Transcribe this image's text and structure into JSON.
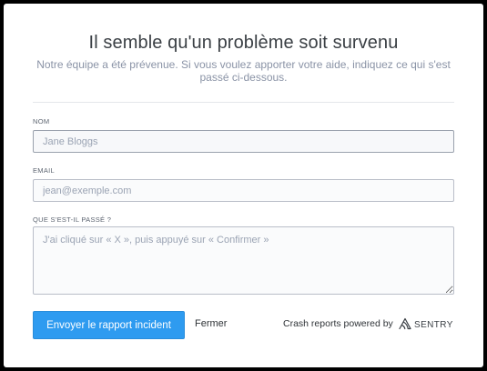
{
  "dialog": {
    "title": "Il semble qu'un problème soit survenu",
    "subtitle": "Notre équipe a été prévenue. Si vous voulez apporter votre aide, indiquez ce qui s'est passé ci-dessous."
  },
  "form": {
    "name_label": "Nom",
    "name_placeholder": "Jane Bloggs",
    "email_label": "Email",
    "email_placeholder": "jean@exemple.com",
    "comments_label": "Que s'est-il passé ?",
    "comments_placeholder": "J'ai cliqué sur « X », puis appuyé sur « Confirmer »"
  },
  "actions": {
    "submit_label": "Envoyer le rapport incident",
    "close_label": "Fermer"
  },
  "footer": {
    "powered_by": "Crash reports powered by",
    "brand": "SENTRY",
    "brand_icon": "sentry-logo-icon"
  },
  "colors": {
    "accent": "#2e9bf0",
    "title": "#3a3f44",
    "subtitle": "#8a93a6",
    "input_border": "#b9bec8"
  }
}
